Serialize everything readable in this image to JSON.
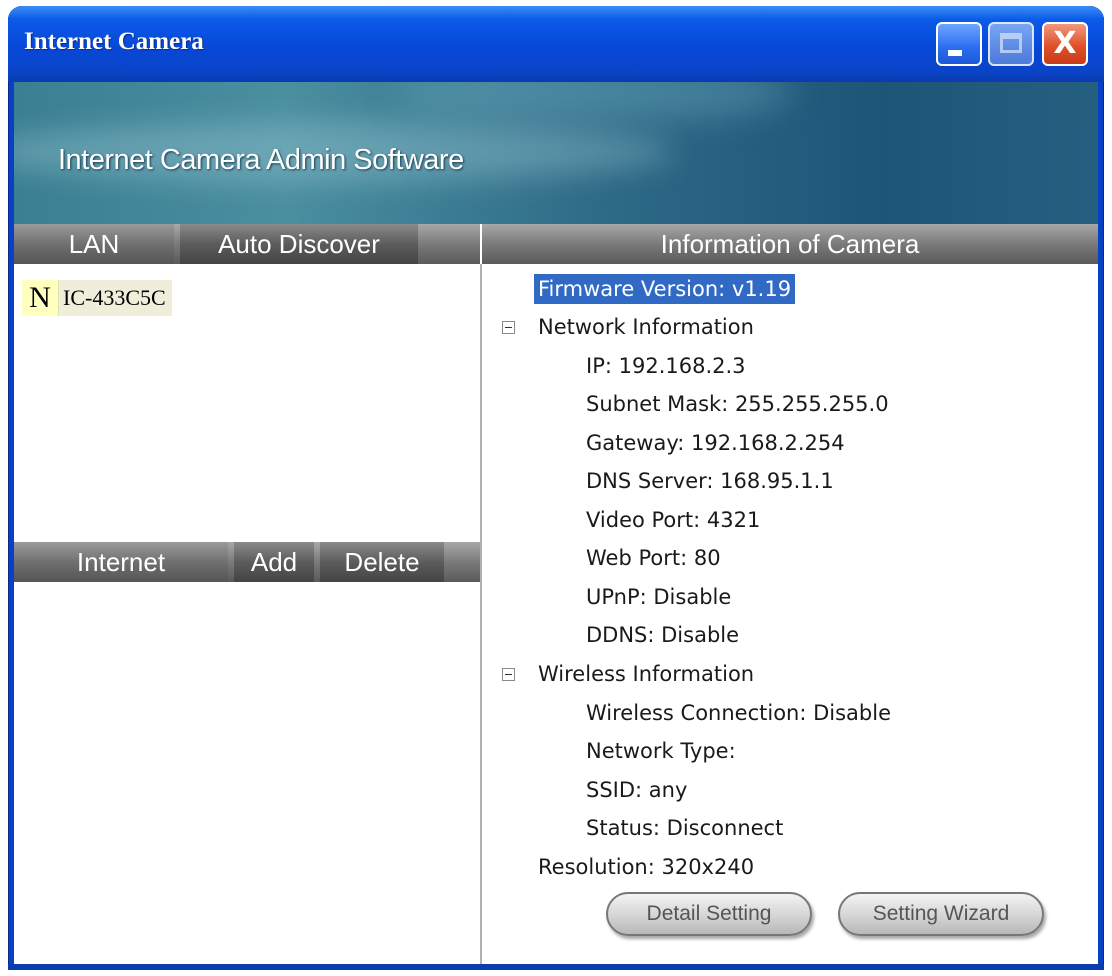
{
  "window": {
    "title": "Internet Camera",
    "controls": {
      "minimize_icon": "minimize-icon",
      "maximize_icon": "maximize-icon",
      "close_icon": "close-icon",
      "close_glyph": "X"
    }
  },
  "banner": {
    "title": "Internet Camera Admin Software"
  },
  "lan_panel": {
    "tabs": [
      "LAN",
      "Auto Discover"
    ],
    "devices": [
      {
        "icon_letter": "N",
        "name": "IC-433C5C"
      }
    ]
  },
  "internet_panel": {
    "tabs": [
      "Internet",
      "Add",
      "Delete"
    ]
  },
  "info_panel": {
    "header": "Information of Camera",
    "firmware": "Firmware Version: v1.19",
    "network": {
      "heading": "Network Information",
      "items": [
        "IP:  192.168.2.3",
        "Subnet Mask:  255.255.255.0",
        "Gateway:  192.168.2.254",
        "DNS Server:  168.95.1.1",
        "Video Port:  4321",
        "Web Port:  80",
        "UPnP:  Disable",
        "DDNS:  Disable"
      ]
    },
    "wireless": {
      "heading": "Wireless Information",
      "items": [
        "Wireless Connection: Disable",
        "Network Type:",
        "SSID: any",
        "Status: Disconnect"
      ]
    },
    "resolution": "Resolution: 320x240",
    "buttons": {
      "detail": "Detail Setting",
      "wizard": "Setting Wizard"
    }
  },
  "colors": {
    "titlebar": "#0a48d8",
    "selection": "#316ac5",
    "tab_gray": "#6a6a6a"
  }
}
